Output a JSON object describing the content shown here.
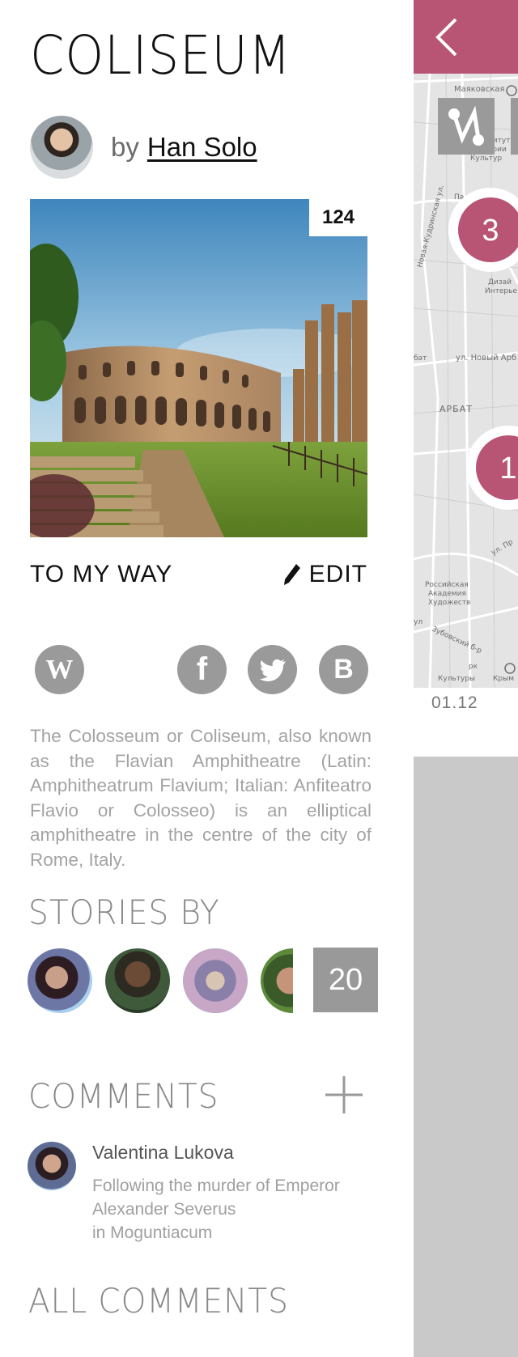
{
  "place": {
    "title": "COLISEUM",
    "by_label": "by",
    "author": "Han Solo"
  },
  "photo": {
    "count": "124"
  },
  "actions": {
    "way_label": "TO MY WAY",
    "edit_label": "EDIT"
  },
  "social": {
    "wiki": "W",
    "facebook": "f",
    "blog": "B"
  },
  "description": "The Colosseum or Coliseum, also known as the Flavian Amphitheatre (Latin: Amphitheatrum Flavium; Italian: Anfiteatro Flavio or Colosseo) is an elliptical amphitheatre in the centre of the city of Rome, Italy.",
  "stories": {
    "heading": "STORIES BY",
    "more_count": "20"
  },
  "comments": {
    "heading": "COMMENTS",
    "items": [
      {
        "author": "Valentina Lukova",
        "text_line1": "Following the murder of Emperor",
        "text_line2": "Alexander Severus",
        "text_line3": "in Moguntiacum"
      }
    ],
    "all_label": "ALL COMMENTS"
  },
  "side": {
    "accent_color": "#b85474",
    "date": "01.12",
    "map_labels": {
      "mayakovskaya": "Маяковская",
      "institut": "Институт",
      "istorii": "Истории",
      "kultur": "Культур",
      "street_kudrinskaya": "Новая-Кудринская ул.",
      "dizain": "Дизай",
      "interer": "Интерье",
      "novy_arbat": "ул. Новый Арб",
      "bat": "бат",
      "arbat": "АРБАТ",
      "rossiyskaya": "Российская",
      "akademiya": "Академия",
      "khudozhestv": "Художеств",
      "zubovsky": "Зубовский б-р",
      "kultury": "Культуры",
      "krym": "Крым",
      "park": "рк",
      "pa": "Па",
      "ul_pr": "ул. Пр",
      "ul": "ул"
    },
    "markers": [
      "3",
      "1"
    ]
  }
}
